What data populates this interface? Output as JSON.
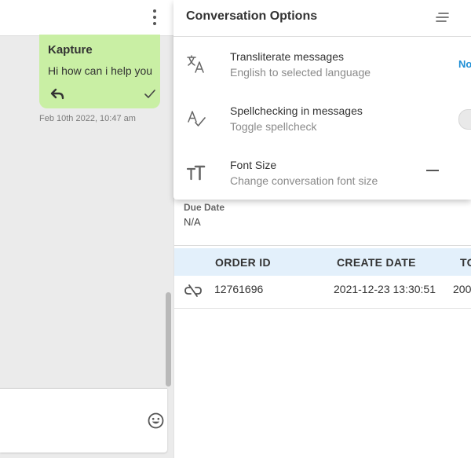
{
  "chat": {
    "message": {
      "sender": "Kapture",
      "text": "Hi how can i help you",
      "timestamp": "Feb 10th 2022, 10:47 am"
    }
  },
  "details": {
    "due_date_label": "Due Date",
    "due_date_value": "N/A",
    "table": {
      "headers": [
        "ORDER ID",
        "CREATE DATE",
        "TO"
      ],
      "rows": [
        [
          "12761696",
          "2021-12-23 13:30:51",
          "200"
        ]
      ]
    }
  },
  "options": {
    "title": "Conversation Options",
    "items": [
      {
        "title": "Transliterate messages",
        "subtitle": "English to selected language",
        "action": "No",
        "icon": "translate-icon"
      },
      {
        "title": "Spellchecking in messages",
        "subtitle": "Toggle spellcheck",
        "icon": "spellcheck-icon"
      },
      {
        "title": "Font Size",
        "subtitle": "Change conversation font size",
        "icon": "font-size-icon"
      }
    ]
  },
  "colors": {
    "bubble": "#c9efa4",
    "table_header": "#e3f0fb",
    "accent": "#1f8fd6",
    "chat_bg": "#ebebeb"
  }
}
